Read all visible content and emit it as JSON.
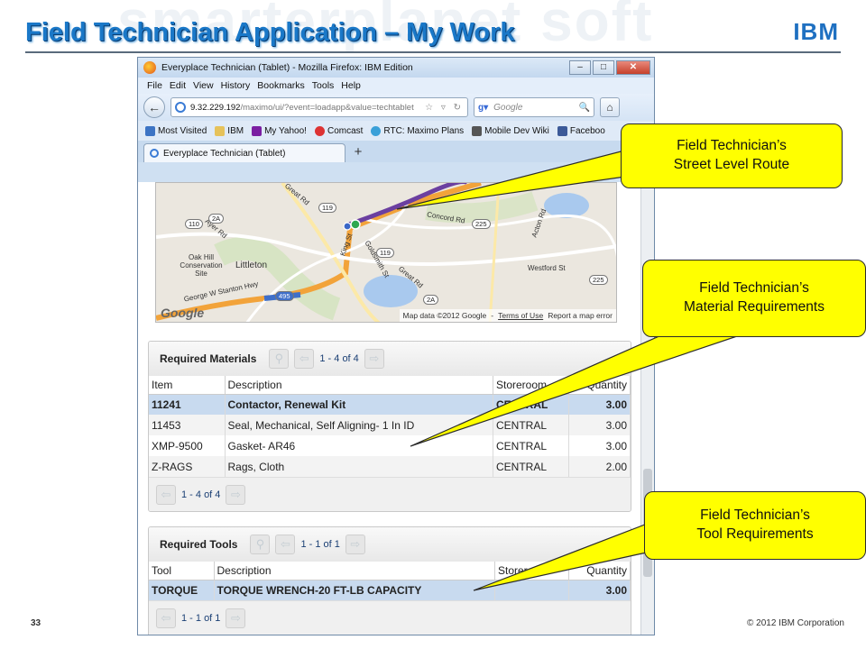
{
  "slide": {
    "watermark": "smarterplanet soft",
    "title": "Field Technician Application – My Work",
    "logo": "IBM",
    "page_number": "33",
    "copyright": "© 2012 IBM Corporation"
  },
  "browser": {
    "window_title": "Everyplace Technician (Tablet) - Mozilla Firefox: IBM Edition",
    "window_buttons": [
      "–",
      "□",
      "✕"
    ],
    "menu": [
      "File",
      "Edit",
      "View",
      "History",
      "Bookmarks",
      "Tools",
      "Help"
    ],
    "url_host": "9.32.229.192",
    "url_path": "/maximo/ui/?event=loadapp&value=techtablet",
    "search_engine": "Google",
    "search_placeholder": "Google",
    "bookmarks": [
      "Most Visited",
      "IBM",
      "My Yahoo!",
      "Comcast",
      "RTC: Maximo Plans",
      "Mobile Dev Wiki",
      "Faceboo"
    ],
    "tab_title": "Everyplace Technician (Tablet)",
    "new_tab": "+"
  },
  "map": {
    "labels": [
      "Great Rd",
      "Concord Rd",
      "Littleton",
      "Oak Hill Conservation Site",
      "George W Stanton Hwy",
      "King St",
      "Goldsmith St",
      "Great Rd",
      "Westford St",
      "Acton Rd",
      "Ayer Rd"
    ],
    "route_shields": [
      "110",
      "2A",
      "119",
      "225",
      "119",
      "495",
      "2A",
      "225"
    ],
    "google_logo": "Google",
    "attribution": "Map data ©2012 Google",
    "terms": "Terms of Use",
    "report": "Report a map error",
    "route_color": "#6b3fa0",
    "highway_color": "#f2a33a"
  },
  "materials": {
    "title": "Required Materials",
    "count": "1 - 4 of 4",
    "footer_count": "1 - 4 of 4",
    "columns": [
      "Item",
      "Description",
      "Storeroom",
      "Quantity"
    ],
    "rows": [
      [
        "11241",
        "Contactor, Renewal Kit",
        "CENTRAL",
        "3.00"
      ],
      [
        "11453",
        "Seal, Mechanical, Self Aligning- 1 In ID",
        "CENTRAL",
        "3.00"
      ],
      [
        "XMP-9500",
        "Gasket- AR46",
        "CENTRAL",
        "3.00"
      ],
      [
        "Z-RAGS",
        "Rags, Cloth",
        "CENTRAL",
        "2.00"
      ]
    ]
  },
  "tools": {
    "title": "Required Tools",
    "count": "1 - 1 of 1",
    "footer_count": "1 - 1 of 1",
    "columns": [
      "Tool",
      "Description",
      "Storeroom",
      "Quantity"
    ],
    "rows": [
      [
        "TORQUE",
        "TORQUE WRENCH-20 FT-LB CAPACITY",
        "",
        "3.00"
      ]
    ]
  },
  "callouts": {
    "route": [
      "Field Technician’s",
      "Street Level Route"
    ],
    "materials": [
      "Field Technician’s",
      "Material Requirements"
    ],
    "tools": [
      "Field Technician’s",
      "Tool Requirements"
    ]
  },
  "colors": {
    "title_blue": "#1a78c8",
    "callout_yellow": "#ffff00",
    "selected_row": "#c8daef"
  }
}
